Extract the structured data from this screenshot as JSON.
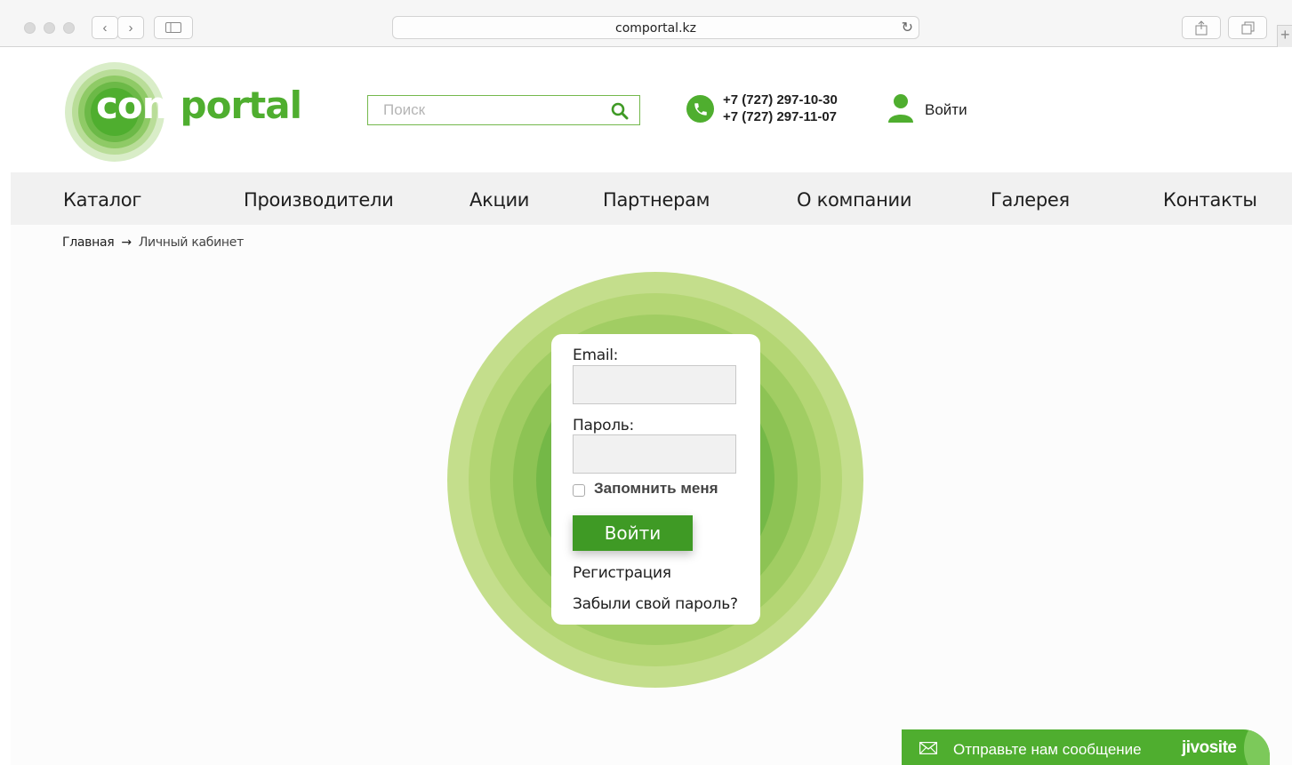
{
  "browser": {
    "url": "comportal.kz",
    "back_glyph": "‹",
    "forward_glyph": "›",
    "reload_glyph": "↻",
    "new_tab_glyph": "+"
  },
  "header": {
    "logo_com": "com",
    "logo_rest": "portal",
    "search_placeholder": "Поиск",
    "phone_1": "+7 (727) 297-10-30",
    "phone_2": "+7 (727) 297-11-07",
    "login_label": "Войти"
  },
  "nav": {
    "items": [
      {
        "label": "Каталог"
      },
      {
        "label": "Производители"
      },
      {
        "label": "Акции"
      },
      {
        "label": "Партнерам"
      },
      {
        "label": "О компании"
      },
      {
        "label": "Галерея"
      },
      {
        "label": "Контакты"
      }
    ]
  },
  "breadcrumb": {
    "home": "Главная",
    "arrow": "→",
    "current": "Личный кабинет"
  },
  "login_form": {
    "email_label": "Email:",
    "password_label": "Пароль:",
    "remember_label": "Запомнить меня",
    "submit_label": "Войти",
    "register_link": "Регистрация",
    "forgot_link": "Забыли свой пароль?"
  },
  "chat_widget": {
    "message": "Отправьте нам сообщение",
    "brand": "jivosite"
  },
  "colors": {
    "brand_green": "#4fae2f",
    "button_green": "#3f9a25",
    "nav_bg": "#f1f1f1"
  }
}
